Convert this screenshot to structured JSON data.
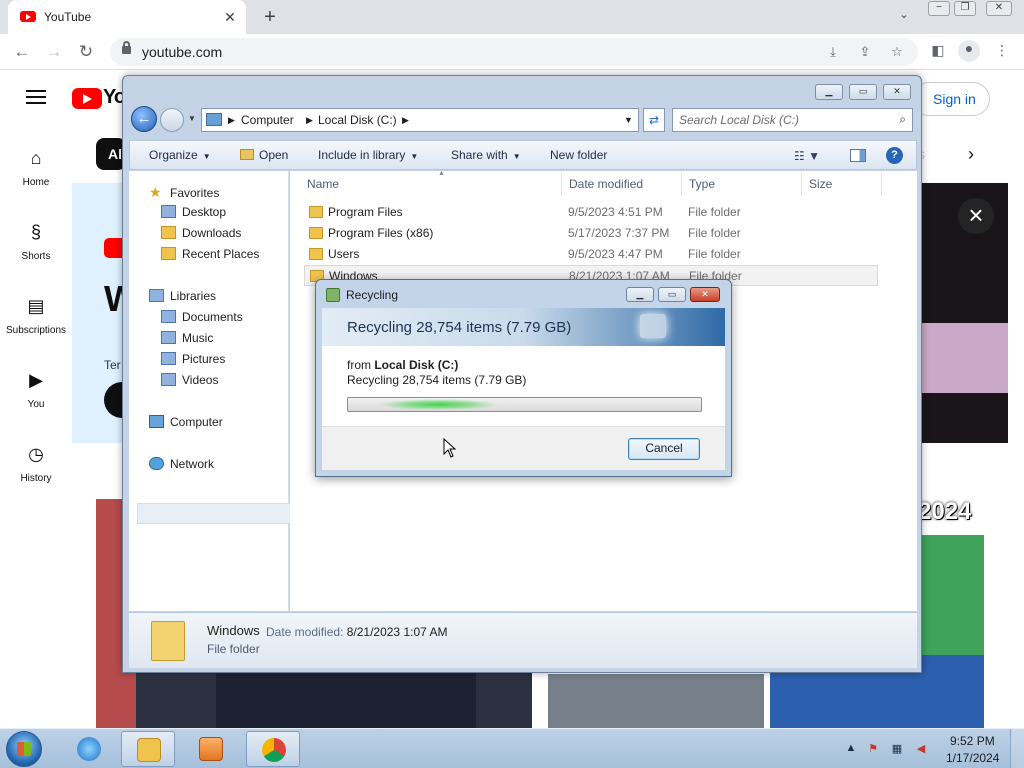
{
  "browser": {
    "tab_title": "YouTube",
    "tab_close": "✕",
    "new_tab": "+",
    "url": "youtube.com"
  },
  "youtube": {
    "logo_text": "Yo",
    "sidebar": [
      {
        "label": "Home",
        "icon": "home-icon"
      },
      {
        "label": "Shorts",
        "icon": "shorts-icon"
      },
      {
        "label": "Subscriptions",
        "icon": "subscriptions-icon"
      },
      {
        "label": "You",
        "icon": "you-icon"
      },
      {
        "label": "History",
        "icon": "history-icon"
      }
    ],
    "sign_in": "Sign in",
    "chip_all": "Al",
    "banner_letter": "W",
    "banner_text": "Ter",
    "thumb_text": "2024",
    "chip_faded": "s"
  },
  "explorer": {
    "address": [
      "Computer",
      "Local Disk (C:)"
    ],
    "search_placeholder": "Search Local Disk (C:)",
    "commands": {
      "organize": "Organize",
      "open": "Open",
      "include_in_library": "Include in library",
      "share_with": "Share with",
      "new_folder": "New folder"
    },
    "nav": {
      "favorites": "Favorites",
      "desktop": "Desktop",
      "downloads": "Downloads",
      "recent_places": "Recent Places",
      "libraries": "Libraries",
      "documents": "Documents",
      "music": "Music",
      "pictures": "Pictures",
      "videos": "Videos",
      "computer": "Computer",
      "network": "Network"
    },
    "columns": {
      "name": "Name",
      "date_modified": "Date modified",
      "type": "Type",
      "size": "Size"
    },
    "rows": [
      {
        "name": "Program Files",
        "date": "9/5/2023 4:51 PM",
        "type": "File folder"
      },
      {
        "name": "Program Files (x86)",
        "date": "5/17/2023 7:37 PM",
        "type": "File folder"
      },
      {
        "name": "Users",
        "date": "9/5/2023 4:47 PM",
        "type": "File folder"
      },
      {
        "name": "Windows",
        "date": "8/21/2023 1:07 AM",
        "type": "File folder"
      }
    ],
    "details": {
      "name": "Windows",
      "date_label": "Date modified:",
      "date_value": "8/21/2023 1:07 AM",
      "type": "File folder"
    }
  },
  "dialog": {
    "title": "Recycling",
    "header": "Recycling 28,754 items (7.79 GB)",
    "from_label": "from",
    "from_value": "Local Disk (C:)",
    "sub": "Recycling 28,754 items (7.79 GB)",
    "cancel": "Cancel"
  },
  "taskbar": {
    "time": "9:52 PM",
    "date": "1/17/2024"
  },
  "colors": {
    "youtube_red": "#ff0000",
    "link_blue": "#065fd4",
    "progress_green": "#42d44a"
  }
}
